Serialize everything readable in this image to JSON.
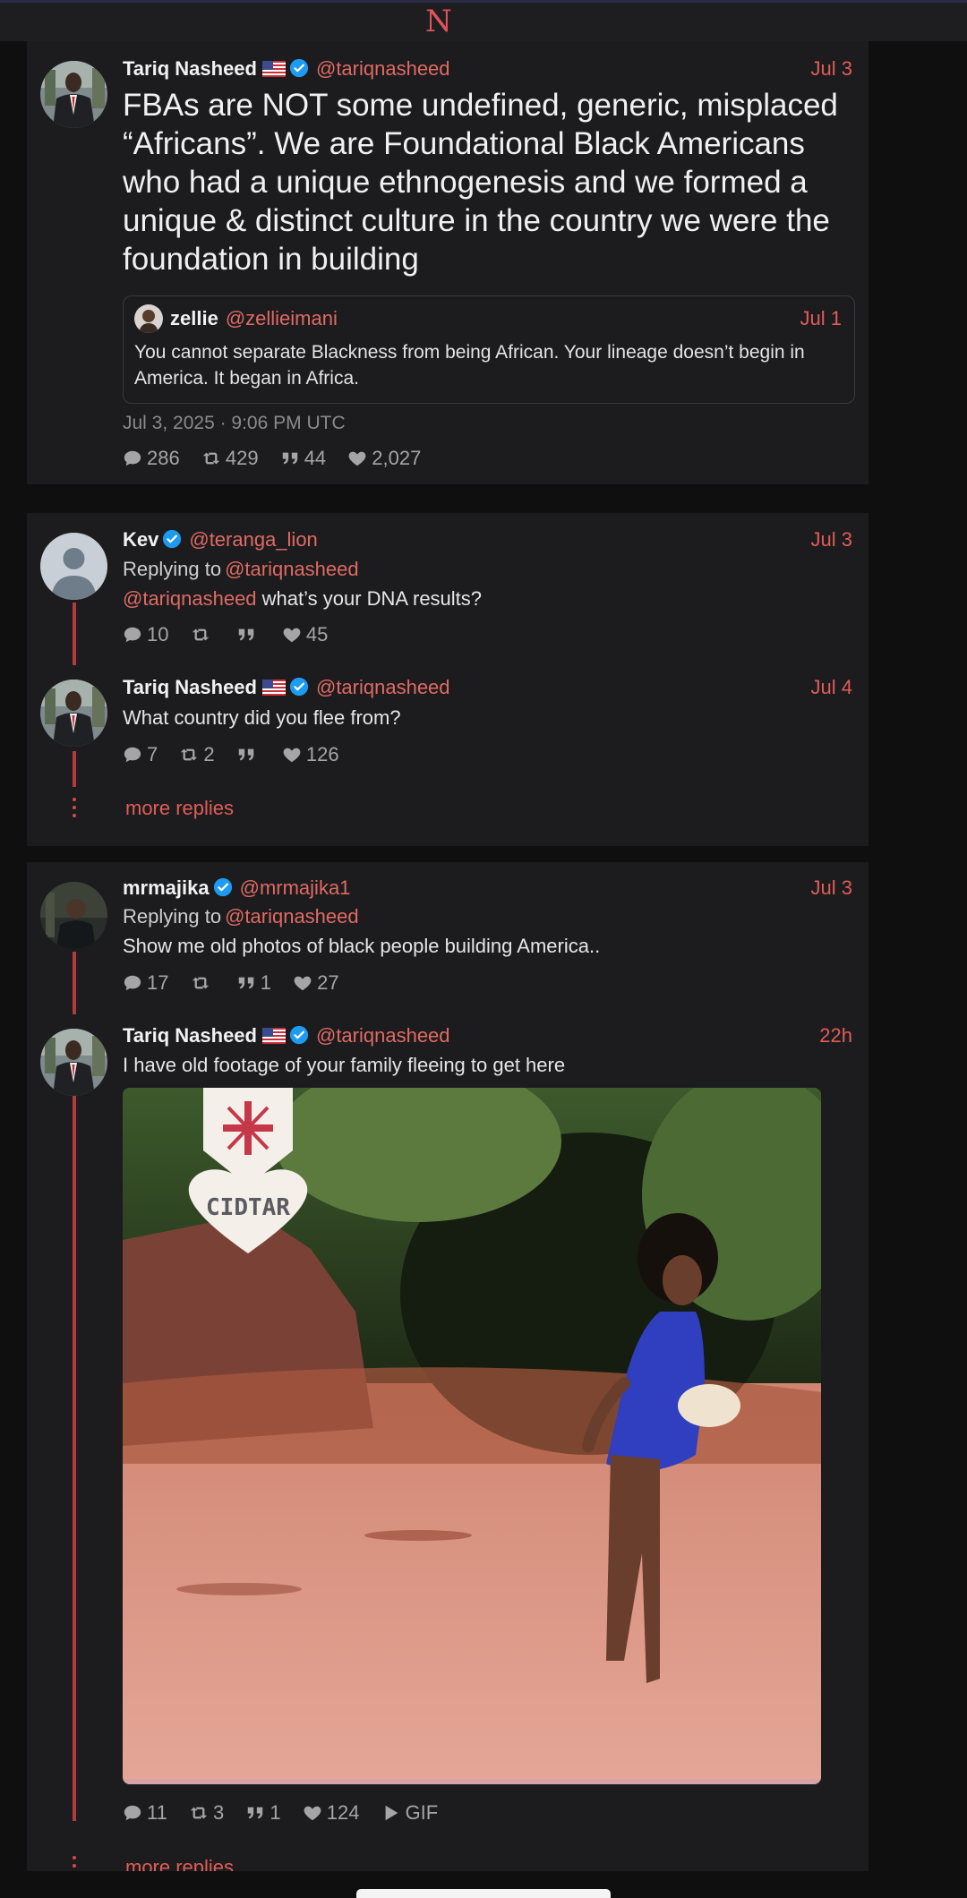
{
  "app": {
    "logo_text": "N"
  },
  "main_tweet": {
    "name": "Tariq Nasheed",
    "handle": "@tariqnasheed",
    "date": "Jul 3",
    "text": "FBAs are NOT some undefined, generic, misplaced “Africans”. We are Foundational Black Americans who had a unique ethnogenesis and we formed a unique & distinct culture in the country we were the foundation in building",
    "quote": {
      "name": "zellie",
      "handle": "@zellieimani",
      "date": "Jul 1",
      "text": "You cannot separate Blackness from being African. Your lineage doesn’t begin in America. It began in Africa."
    },
    "timestamp": "Jul 3, 2025 · 9:06 PM UTC",
    "stats": {
      "replies": "286",
      "retweets": "429",
      "quotes": "44",
      "likes": "2,027"
    }
  },
  "thread1": {
    "reply": {
      "name": "Kev",
      "handle": "@teranga_lion",
      "date": "Jul 3",
      "replying_label": "Replying to",
      "replying_handle": "@tariqnasheed",
      "mention": "@tariqnasheed",
      "text": " what’s your DNA results?",
      "stats": {
        "replies": "10",
        "retweets": "",
        "quotes": "",
        "likes": "45"
      }
    },
    "answer": {
      "name": "Tariq Nasheed",
      "handle": "@tariqnasheed",
      "date": "Jul 4",
      "text": "What country did you flee from?",
      "stats": {
        "replies": "7",
        "retweets": "2",
        "quotes": "",
        "likes": "126"
      }
    },
    "more_label": "more replies"
  },
  "thread2": {
    "reply": {
      "name": "mrmajika",
      "handle": "@mrmajika1",
      "date": "Jul 3",
      "replying_label": "Replying to",
      "replying_handle": "@tariqnasheed",
      "text": "Show me old photos of black people building America..",
      "stats": {
        "replies": "17",
        "retweets": "",
        "quotes": "1",
        "likes": "27"
      }
    },
    "answer": {
      "name": "Tariq Nasheed",
      "handle": "@tariqnasheed",
      "date": "22h",
      "text": "I have old footage of your family fleeing to get here",
      "media_sign_text": "CIDTAR",
      "stats": {
        "replies": "11",
        "retweets": "3",
        "quotes": "1",
        "likes": "124",
        "gif_label": "GIF"
      }
    },
    "more_label": "more replies"
  },
  "colors": {
    "accent": "#e05d57",
    "verified": "#1d9bf0",
    "card_bg": "#1c1c1e",
    "thread_line": "#b03a3e"
  },
  "icons": [
    "comment-icon",
    "retweet-icon",
    "quote-icon",
    "heart-icon",
    "play-icon",
    "verified-icon",
    "us-flag-icon"
  ]
}
